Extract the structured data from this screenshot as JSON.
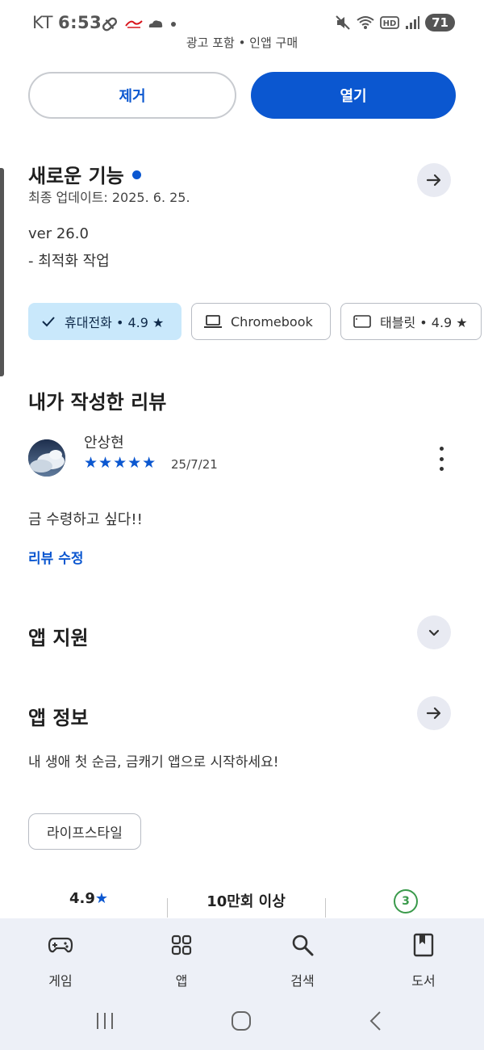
{
  "status_bar": {
    "carrier": "KT",
    "time": "6:53",
    "battery": "71"
  },
  "ad_note": "광고 포함 • 인앱 구매",
  "actions": {
    "remove_label": "제거",
    "open_label": "열기"
  },
  "whats_new": {
    "title": "새로운 기능",
    "updated": "최종 업데이트: 2025. 6. 25.",
    "version": "ver 26.0",
    "note": "- 최적화 작업"
  },
  "device_chips": [
    {
      "label": "휴대전화 • 4.9 ★",
      "icon": "check-icon",
      "selected": true
    },
    {
      "label": "Chromebook",
      "icon": "laptop-icon",
      "selected": false
    },
    {
      "label": "태블릿 • 4.9 ★",
      "icon": "tablet-icon",
      "selected": false
    }
  ],
  "my_review": {
    "title": "내가 작성한 리뷰",
    "reviewer": "안상현",
    "stars": "★★★★★",
    "rating": 5,
    "date": "25/7/21",
    "text": "금 수령하고 싶다!!",
    "edit_link": "리뷰 수정"
  },
  "app_support": {
    "title": "앱 지원"
  },
  "app_info": {
    "title": "앱 정보",
    "description": "내 생애 첫 순금, 금캐기 앱으로 시작하세요!",
    "category": "라이프스타일"
  },
  "stats": {
    "rating": "4.9★",
    "downloads": "10만회 이상",
    "age": "3"
  },
  "bottom_nav": [
    {
      "label": "게임",
      "icon": "gamepad-icon"
    },
    {
      "label": "앱",
      "icon": "apps-grid-icon"
    },
    {
      "label": "검색",
      "icon": "search-icon"
    },
    {
      "label": "도서",
      "icon": "book-icon"
    }
  ],
  "colors": {
    "primary": "#0b57d0",
    "chip_selected": "#c9e8fb",
    "nav_bg": "#edf0f7",
    "age_badge": "#3a9a4b"
  }
}
